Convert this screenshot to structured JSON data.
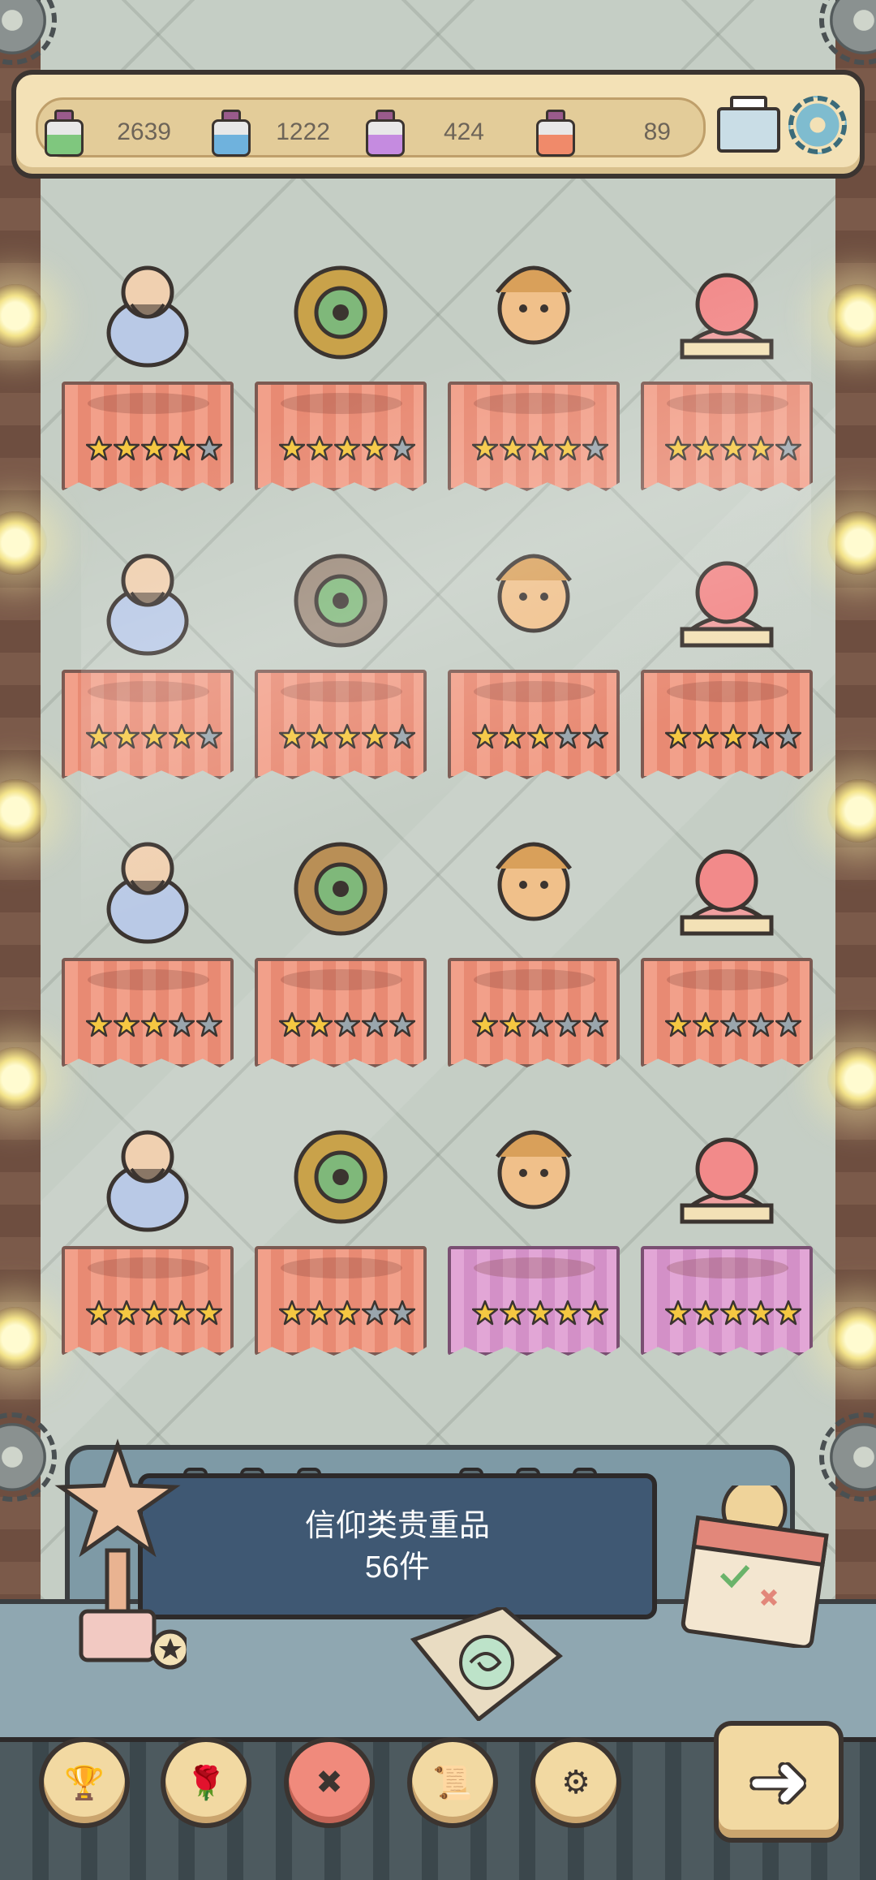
{
  "resources": [
    {
      "name": "green-potion",
      "value": "2639",
      "color": "#7fc77e"
    },
    {
      "name": "blue-potion",
      "value": "1222",
      "color": "#6fb2dd"
    },
    {
      "name": "purple-potion",
      "value": "424",
      "color": "#c58be0"
    },
    {
      "name": "orange-potion",
      "value": "89",
      "color": "#f08a6a"
    }
  ],
  "header": {
    "mail_icon": "mail-icon",
    "settings_icon": "gear-icon"
  },
  "shelves": [
    {
      "items": [
        {
          "name": "bearded-sage-bust",
          "stars": 4,
          "max": 5,
          "cloth": "orange"
        },
        {
          "name": "eye-amulet",
          "stars": 4,
          "max": 5,
          "cloth": "orange"
        },
        {
          "name": "three-faced-head",
          "stars": 4,
          "max": 5,
          "cloth": "orange"
        },
        {
          "name": "lotus-pastry",
          "stars": 4,
          "max": 5,
          "cloth": "orange"
        }
      ]
    },
    {
      "items": [
        {
          "name": "pointing-finger-statue",
          "stars": 4,
          "max": 5,
          "cloth": "orange"
        },
        {
          "name": "bread-basket",
          "stars": 4,
          "max": 5,
          "cloth": "orange"
        },
        {
          "name": "horse-chariot",
          "stars": 3,
          "max": 5,
          "cloth": "orange"
        },
        {
          "name": "carved-stone-tablet",
          "stars": 3,
          "max": 5,
          "cloth": "orange"
        }
      ]
    },
    {
      "items": [
        {
          "name": "cloud-spirit",
          "stars": 3,
          "max": 5,
          "cloth": "orange"
        },
        {
          "name": "golden-ark",
          "stars": 2,
          "max": 5,
          "cloth": "orange"
        },
        {
          "name": "golden-apple",
          "stars": 2,
          "max": 5,
          "cloth": "orange"
        },
        {
          "name": "ancient-scroll",
          "stars": 2,
          "max": 5,
          "cloth": "orange"
        }
      ]
    },
    {
      "items": [
        {
          "name": "scarab-beetle",
          "stars": 5,
          "max": 5,
          "cloth": "orange"
        },
        {
          "name": "magic-lamp",
          "stars": 3,
          "max": 5,
          "cloth": "orange"
        },
        {
          "name": "thorned-coffin",
          "stars": 5,
          "max": 5,
          "cloth": "pink"
        },
        {
          "name": "feather-quill",
          "stars": 5,
          "max": 5,
          "cloth": "pink"
        }
      ]
    }
  ],
  "console": {
    "title": "信仰类贵重品",
    "count": "56件"
  },
  "nav": [
    {
      "name": "trophy-cup-icon",
      "active": false
    },
    {
      "name": "rose-icon",
      "active": false
    },
    {
      "name": "crossed-tools-icon",
      "active": true
    },
    {
      "name": "scroll-map-icon",
      "active": false
    },
    {
      "name": "cog-icon",
      "active": false
    }
  ],
  "next_icon": "arrow-right-icon"
}
